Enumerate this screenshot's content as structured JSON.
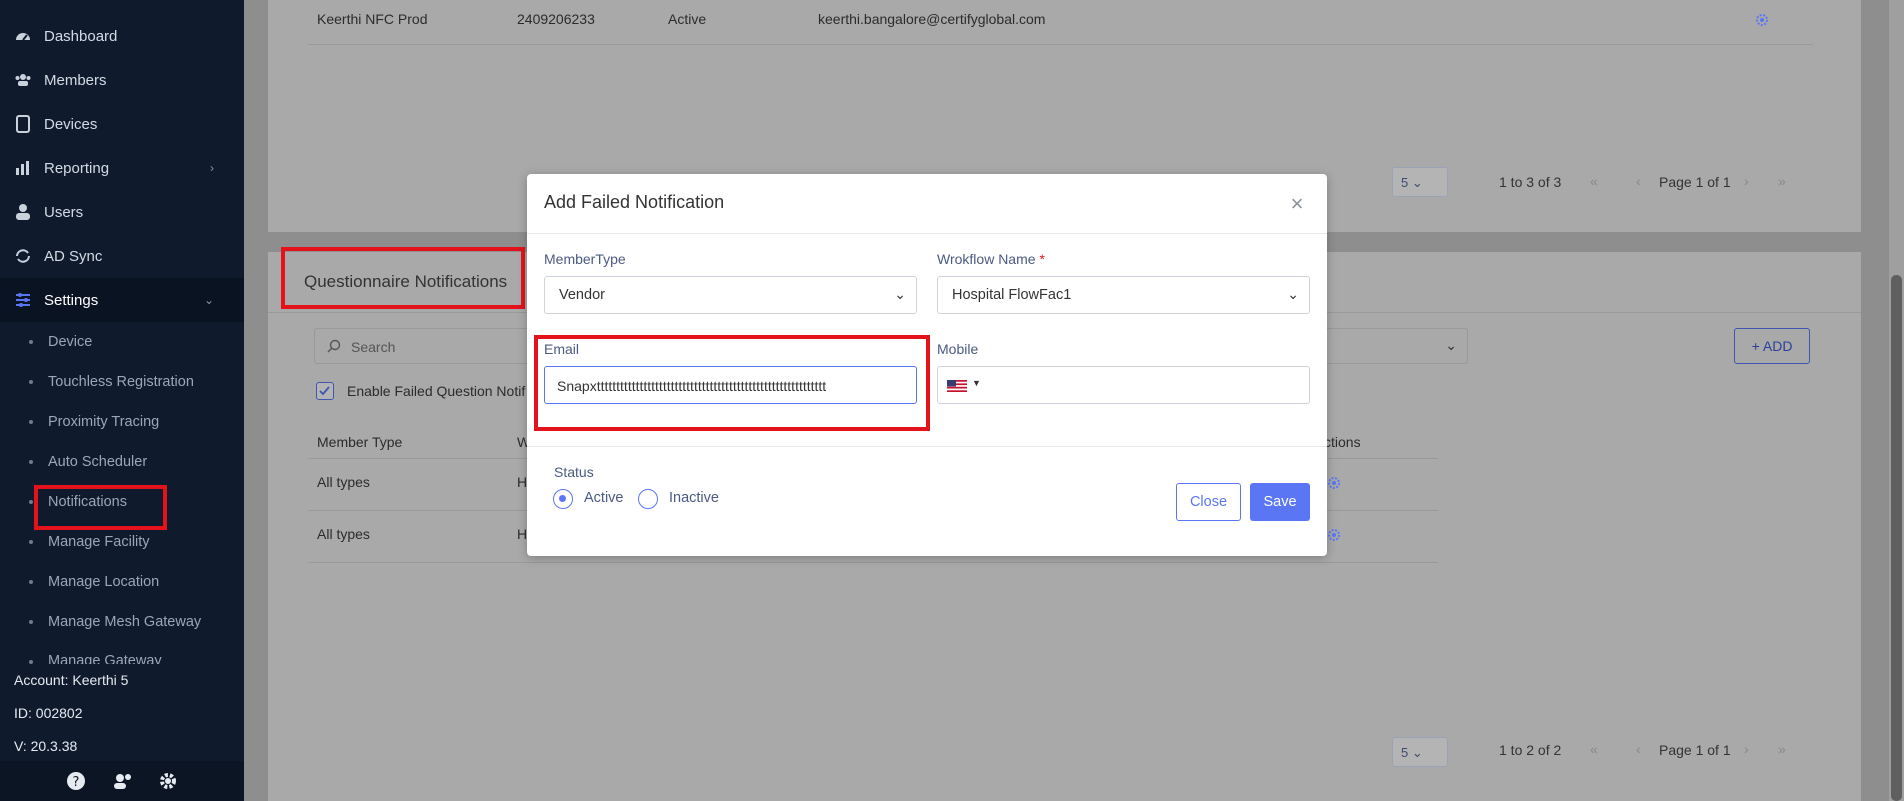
{
  "sidebar": {
    "items": [
      {
        "label": "Dashboard",
        "icon": "dashboard-icon"
      },
      {
        "label": "Members",
        "icon": "users-group-icon"
      },
      {
        "label": "Devices",
        "icon": "tablet-icon"
      },
      {
        "label": "Reporting",
        "icon": "bar-chart-icon"
      },
      {
        "label": "Users",
        "icon": "user-icon"
      },
      {
        "label": "AD Sync",
        "icon": "sync-icon"
      },
      {
        "label": "Settings",
        "icon": "sliders-icon"
      }
    ],
    "sub_items": [
      "Device",
      "Touchless Registration",
      "Proximity Tracing",
      "Auto Scheduler",
      "Notifications",
      "Manage Facility",
      "Manage Location",
      "Manage Mesh Gateway",
      "Manage Gateway"
    ],
    "account": "Account: Keerthi 5",
    "id": "ID: 002802",
    "version": "V: 20.3.38"
  },
  "top_card": {
    "row": {
      "name": "Keerthi NFC Prod",
      "phone": "2409206233",
      "status": "Active",
      "email": "keerthi.bangalore@certifyglobal.com"
    },
    "page_size": "5",
    "range": "1 to 3 of 3",
    "page": "Page 1 of 1"
  },
  "questionnaire_card": {
    "title": "Questionnaire Notifications",
    "search_placeholder": "Search",
    "enable_label": "Enable Failed Question Notif",
    "add_label": "ADD",
    "col_member_type": "Member Type",
    "col_w": "W",
    "col_actions": "ctions",
    "rows": [
      {
        "member_type": "All types",
        "w": "H"
      },
      {
        "member_type": "All types",
        "w": "H"
      }
    ],
    "page_size": "5",
    "range": "1 to 2 of 2",
    "page": "Page 1 of 1"
  },
  "modal": {
    "title": "Add Failed Notification",
    "member_type_label": "MemberType",
    "member_type_value": "Vendor",
    "workflow_label": "Wrokflow Name",
    "workflow_required": "*",
    "workflow_value": "Hospital FlowFac1",
    "email_label": "Email",
    "email_value": "Snapxttttttttttttttttttttttttttttttttttttttttttttttttttttttttttt",
    "mobile_label": "Mobile",
    "status_label": "Status",
    "active_label": "Active",
    "inactive_label": "Inactive",
    "close_label": "Close",
    "save_label": "Save"
  },
  "colors": {
    "accent": "#5a76f5",
    "highlight": "#e3121b",
    "sidebar_bg": "#0f1b2d"
  }
}
